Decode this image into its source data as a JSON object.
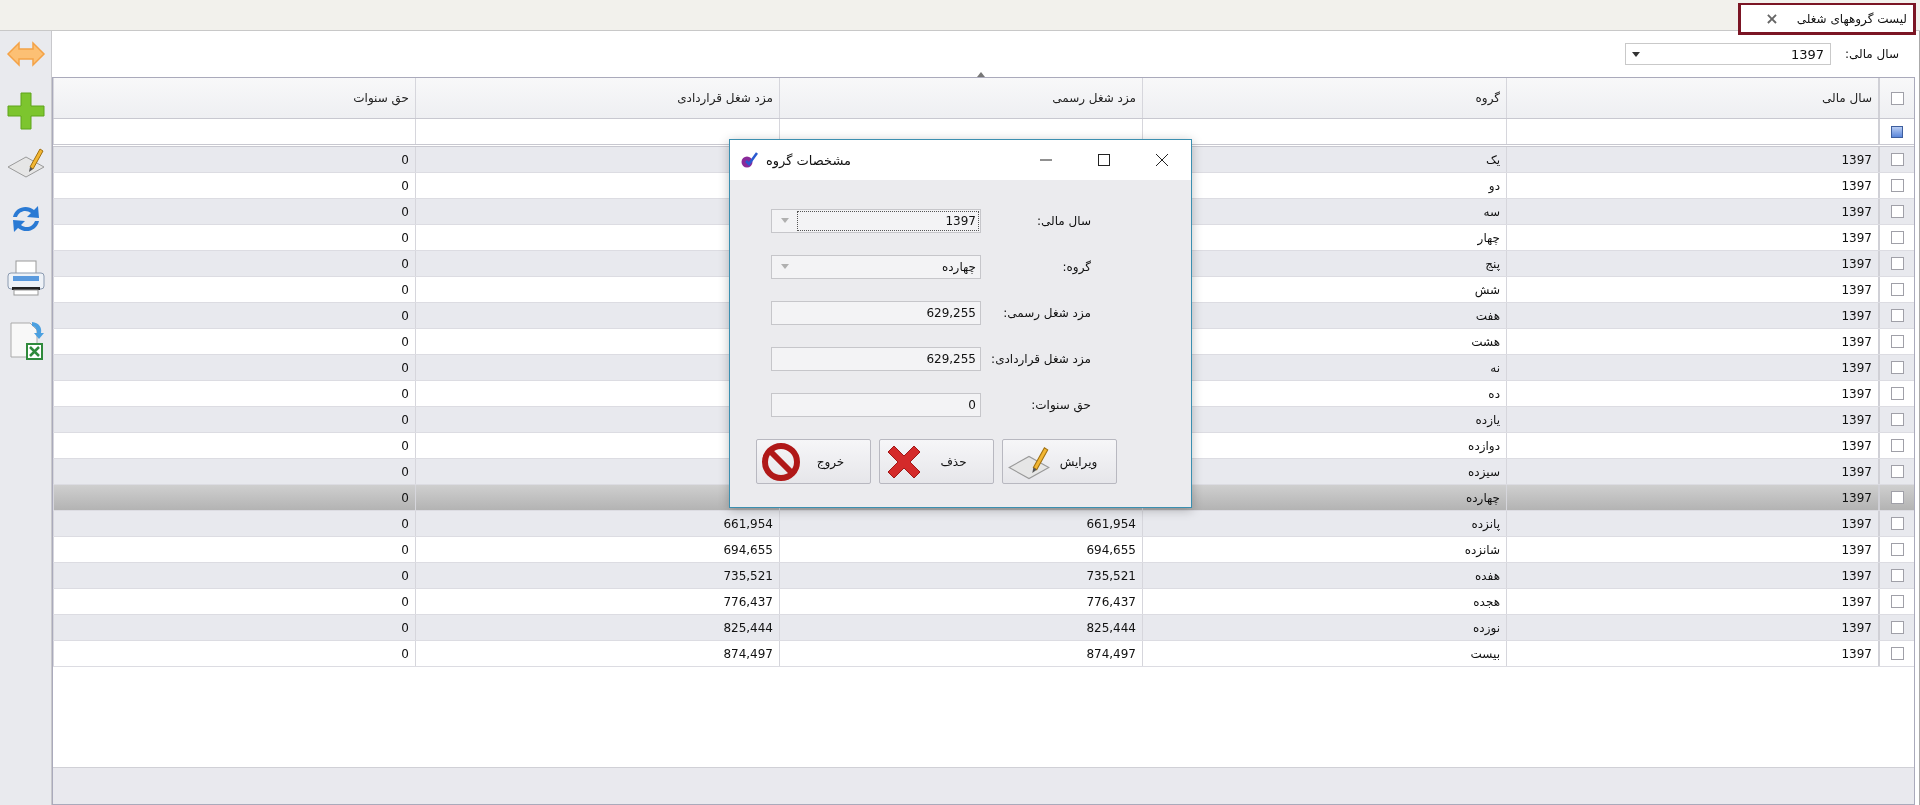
{
  "tab": {
    "title": "لیست گروههای شغلی",
    "close": "×"
  },
  "filter": {
    "label": "سال مالی:",
    "value": "1397"
  },
  "table": {
    "header_checked": false,
    "columns": [
      "سال مالی",
      "گروه",
      "مزد شغل رسمی",
      "مزد شغل قراردادی",
      "حق سنوات"
    ],
    "rows": [
      {
        "year": "1397",
        "group": "یک",
        "severance": "0",
        "checked": false,
        "selected": false
      },
      {
        "year": "1397",
        "group": "دو",
        "severance": "0",
        "checked": false,
        "selected": false
      },
      {
        "year": "1397",
        "group": "سه",
        "severance": "0",
        "checked": false,
        "selected": false
      },
      {
        "year": "1397",
        "group": "چهار",
        "severance": "0",
        "checked": false,
        "selected": false
      },
      {
        "year": "1397",
        "group": "پنج",
        "severance": "0",
        "checked": false,
        "selected": false
      },
      {
        "year": "1397",
        "group": "شش",
        "severance": "0",
        "checked": false,
        "selected": false
      },
      {
        "year": "1397",
        "group": "هفت",
        "severance": "0",
        "checked": false,
        "selected": false
      },
      {
        "year": "1397",
        "group": "هشت",
        "severance": "0",
        "checked": false,
        "selected": false
      },
      {
        "year": "1397",
        "group": "نه",
        "severance": "0",
        "checked": false,
        "selected": false
      },
      {
        "year": "1397",
        "group": "ده",
        "severance": "0",
        "checked": false,
        "selected": false
      },
      {
        "year": "1397",
        "group": "یازده",
        "severance": "0",
        "checked": false,
        "selected": false
      },
      {
        "year": "1397",
        "group": "دوازده",
        "severance": "0",
        "checked": false,
        "selected": false
      },
      {
        "year": "1397",
        "group": "سیزده",
        "severance": "0",
        "checked": false,
        "selected": false
      },
      {
        "year": "1397",
        "group": "چهارده",
        "severance": "0",
        "checked": false,
        "selected": true
      },
      {
        "year": "1397",
        "group": "پانزده",
        "official": "661,954",
        "contract": "661,954",
        "severance": "0",
        "checked": false,
        "selected": false
      },
      {
        "year": "1397",
        "group": "شانزده",
        "official": "694,655",
        "contract": "694,655",
        "severance": "0",
        "checked": false,
        "selected": false
      },
      {
        "year": "1397",
        "group": "هفده",
        "official": "735,521",
        "contract": "735,521",
        "severance": "0",
        "checked": false,
        "selected": false
      },
      {
        "year": "1397",
        "group": "هجده",
        "official": "776,437",
        "contract": "776,437",
        "severance": "0",
        "checked": false,
        "selected": false
      },
      {
        "year": "1397",
        "group": "نوزده",
        "official": "825,444",
        "contract": "825,444",
        "severance": "0",
        "checked": false,
        "selected": false
      },
      {
        "year": "1397",
        "group": "بیست",
        "official": "874,497",
        "contract": "874,497",
        "severance": "0",
        "checked": false,
        "selected": false
      }
    ]
  },
  "dialog": {
    "title": "مشخصات گروه",
    "fields": [
      {
        "kind": "dropdown",
        "label": "سال مالی:",
        "value": "1397",
        "focused": true
      },
      {
        "kind": "dropdown",
        "label": "گروه:",
        "value": "چهارده",
        "focused": false
      },
      {
        "kind": "text",
        "label": "مزد شغل رسمی:",
        "value": "629,255",
        "focused": false
      },
      {
        "kind": "text",
        "label": "مزد شغل قراردادی:",
        "value": "629,255",
        "focused": false
      },
      {
        "kind": "text",
        "label": "حق سنوات:",
        "value": "0",
        "focused": false
      }
    ],
    "buttons": [
      {
        "kind": "edit",
        "label": "ویرایش"
      },
      {
        "kind": "delete",
        "label": "حذف"
      },
      {
        "kind": "exit",
        "label": "خروج"
      }
    ]
  }
}
